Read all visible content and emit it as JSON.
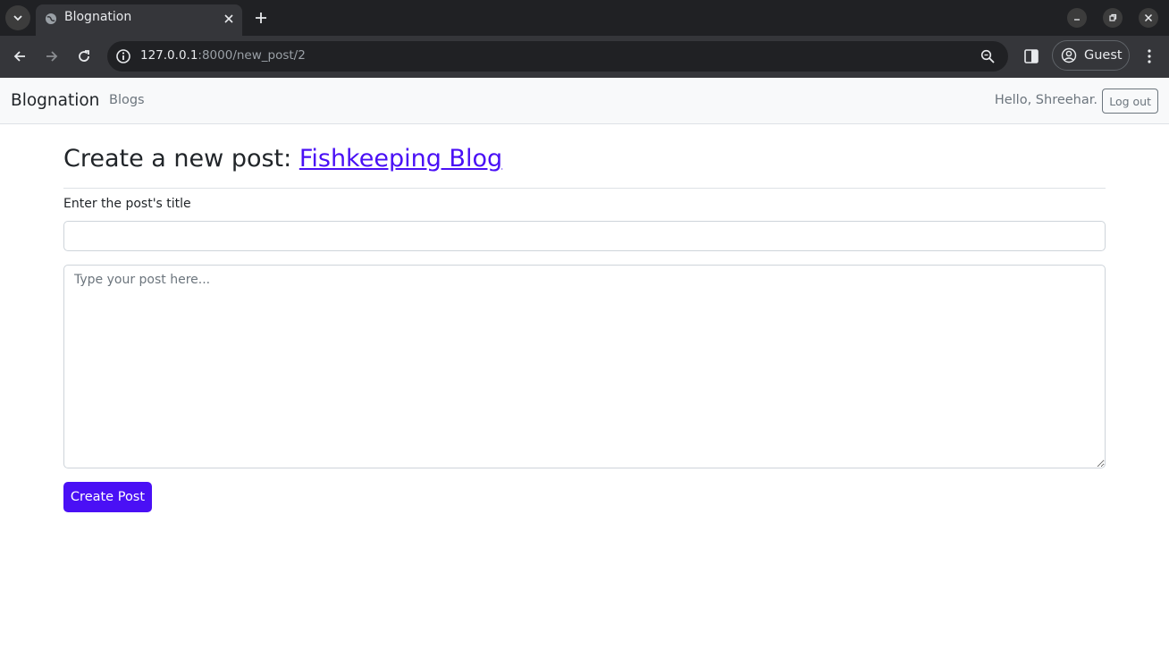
{
  "browser": {
    "tab_title": "Blognation",
    "url_host": "127.0.0.1",
    "url_path": ":8000/new_post/2",
    "profile_label": "Guest",
    "icons": {
      "tab_menu": "chevron-down-icon",
      "favicon": "globe-icon",
      "tab_close": "close-icon",
      "new_tab": "plus-icon",
      "back": "arrow-left-icon",
      "forward": "arrow-right-icon",
      "reload": "reload-icon",
      "site_info": "info-icon",
      "zoom": "zoom-icon",
      "side_panel": "side-panel-icon",
      "profile": "account-circle-icon",
      "menu": "kebab-menu-icon",
      "minimize": "minimize-icon",
      "maximize": "restore-icon",
      "close_window": "close-icon"
    }
  },
  "navbar": {
    "brand": "Blognation",
    "links": [
      "Blogs"
    ],
    "greeting": "Hello, Shreehar.",
    "logout_label": "Log out"
  },
  "main": {
    "heading_prefix": "Create a new post: ",
    "blog_link": "Fishkeeping Blog",
    "title_label": "Enter the post's title",
    "title_value": "",
    "body_placeholder": "Type your post here...",
    "submit_label": "Create Post"
  },
  "colors": {
    "accent": "#4a10f5",
    "navbar_bg": "#f8f9fa",
    "chrome_dark": "#202124",
    "chrome_toolbar": "#35363a"
  }
}
